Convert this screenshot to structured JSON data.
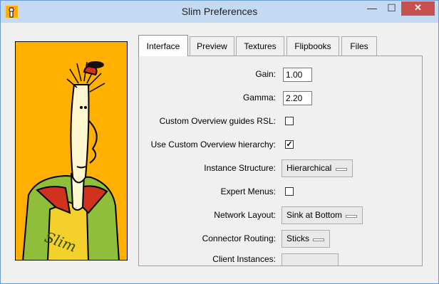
{
  "window": {
    "title": "Slim Preferences"
  },
  "titlebar_buttons": {
    "minimize": "—",
    "maximize": "☐",
    "close": "✕"
  },
  "tabs": [
    {
      "label": "Interface",
      "active": true
    },
    {
      "label": "Preview",
      "active": false
    },
    {
      "label": "Textures",
      "active": false
    },
    {
      "label": "Flipbooks",
      "active": false
    },
    {
      "label": "Files",
      "active": false
    }
  ],
  "interface": {
    "gain": {
      "label": "Gain:",
      "value": "1.00"
    },
    "gamma": {
      "label": "Gamma:",
      "value": "2.20"
    },
    "custom_overview_guides_rsl": {
      "label": "Custom Overview guides RSL:",
      "checked": false
    },
    "use_custom_overview_hierarchy": {
      "label": "Use Custom Overview hierarchy:",
      "checked": true,
      "mark": "✓"
    },
    "instance_structure": {
      "label": "Instance Structure:",
      "value": "Hierarchical"
    },
    "expert_menus": {
      "label": "Expert Menus:",
      "checked": false
    },
    "network_layout": {
      "label": "Network Layout:",
      "value": "Sink at Bottom"
    },
    "connector_routing": {
      "label": "Connector Routing:",
      "value": "Sticks"
    },
    "client_instances": {
      "label": "Client Instances:"
    }
  },
  "colors": {
    "accent_titlebar": "#c4daf3",
    "close_button": "#c75050",
    "art_background": "#ffb000"
  }
}
